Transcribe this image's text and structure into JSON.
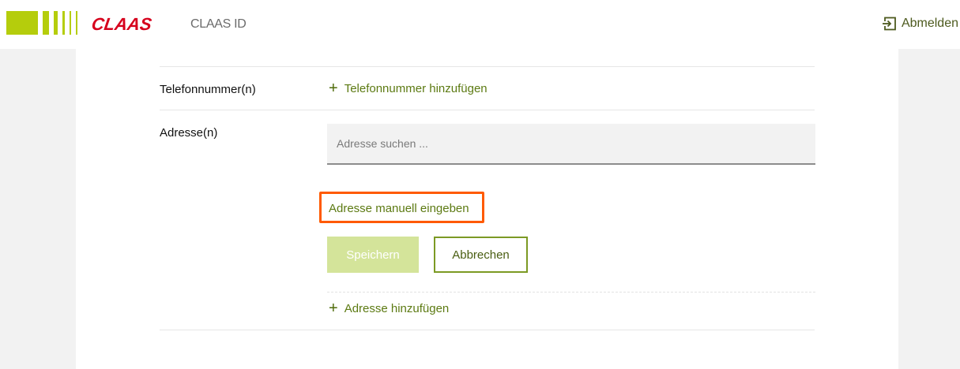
{
  "header": {
    "brand": "CLAAS",
    "app_name": "CLAAS ID",
    "logout_label": "Abmelden"
  },
  "form": {
    "phone": {
      "label": "Telefonnummer(n)",
      "add_label": "Telefonnummer hinzufügen"
    },
    "address": {
      "label": "Adresse(n)",
      "search_placeholder": "Adresse suchen ...",
      "manual_entry_label": "Adresse manuell eingeben",
      "save_label": "Speichern",
      "cancel_label": "Abbrechen",
      "add_label": "Adresse hinzufügen"
    }
  },
  "colors": {
    "brand_red": "#d6001c",
    "accent_green": "#5c7a12",
    "logo_green": "#b5cd0c",
    "highlight_orange": "#ff5a00",
    "save_disabled": "#d4e49a"
  },
  "icons": {
    "logout": "logout-icon",
    "plus": "plus-icon"
  }
}
